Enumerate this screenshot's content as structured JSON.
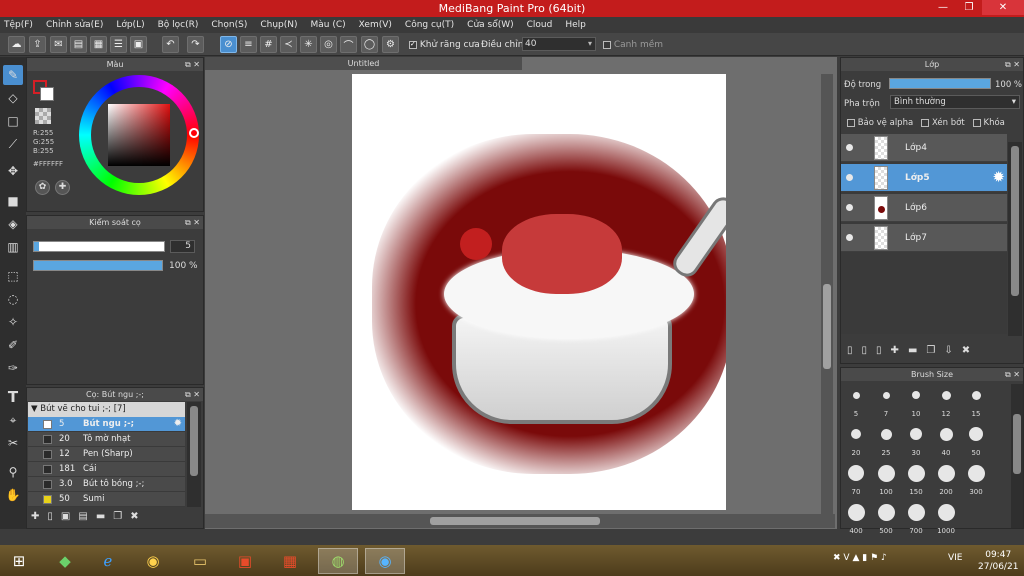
{
  "window": {
    "title": "MediBang Paint Pro (64bit)",
    "minimize": "—",
    "maximize": "❐",
    "close": "✕"
  },
  "menu": [
    "Tệp(F)",
    "Chỉnh sửa(E)",
    "Lớp(L)",
    "Bộ lọc(R)",
    "Chọn(S)",
    "Chụp(N)",
    "Màu (C)",
    "Xem(V)",
    "Công cụ(T)",
    "Cửa sổ(W)",
    "Cloud",
    "Help"
  ],
  "toolbar": {
    "antialias_label": "Khử răng cưa",
    "adjust_label": "Điều chỉnh",
    "adjust_value": "40",
    "smooth_label": "Canh mềm"
  },
  "color_panel": {
    "title": "Màu",
    "r": "R:255",
    "g": "G:255",
    "b": "B:255",
    "hex": "#FFFFFF",
    "primary": "#d61f26",
    "secondary": "#ffffff"
  },
  "brush_control": {
    "title": "Kiểm soát cọ",
    "size": "5",
    "opacity": "100 %",
    "size_fraction": 0.04,
    "opacity_fraction": 1.0
  },
  "brush_panel": {
    "title": "Cọ: Bút ngu ;-;",
    "group": "Bút vẽ cho tui ;-; [7]",
    "items": [
      {
        "size": "5",
        "name": "Bút ngu ;-;",
        "color": "#ffffff"
      },
      {
        "size": "20",
        "name": "Tô mờ nhạt",
        "color": "#2a2a2a"
      },
      {
        "size": "12",
        "name": "Pen (Sharp)",
        "color": "#2a2a2a"
      },
      {
        "size": "181",
        "name": "Cái",
        "color": "#2a2a2a"
      },
      {
        "size": "3.0",
        "name": "Bút tô bóng ;-;",
        "color": "#2a2a2a"
      },
      {
        "size": "50",
        "name": "Sumi",
        "color": "#e8d21a"
      }
    ]
  },
  "canvas": {
    "tab": "Untitled"
  },
  "layer_panel": {
    "title": "Lớp",
    "opacity_label": "Độ trong",
    "opacity_value": "100 %",
    "opacity_fraction": 1.0,
    "blend_label": "Pha trộn",
    "blend_value": "Bình thường",
    "protect_alpha": "Bảo vệ alpha",
    "clip": "Xén bớt",
    "lock": "Khóa",
    "layers": [
      "Lớp4",
      "Lớp5",
      "Lớp6",
      "Lớp7"
    ]
  },
  "brush_size_panel": {
    "title": "Brush Size",
    "sizes": [
      "5",
      "7",
      "10",
      "12",
      "15",
      "20",
      "25",
      "30",
      "40",
      "50",
      "70",
      "100",
      "150",
      "200",
      "300",
      "400",
      "500",
      "700",
      "1000"
    ]
  },
  "taskbar": {
    "lang": "VIE",
    "time": "09:47",
    "date": "27/06/21"
  },
  "colors": {
    "accent": "#4a8fd0",
    "title_bar": "#c31c1c",
    "background": "#3c3c3c"
  }
}
